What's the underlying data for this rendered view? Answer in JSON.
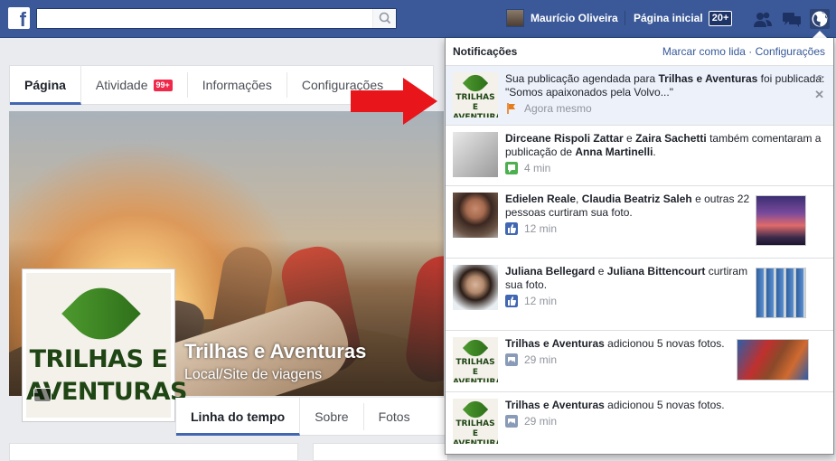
{
  "topbar": {
    "search_placeholder": "",
    "user_name": "Maurício Oliveira",
    "home_label": "Página inicial",
    "home_badge": "20+"
  },
  "page_nav": {
    "tabs": [
      {
        "label": "Página"
      },
      {
        "label": "Atividade",
        "badge": "99+"
      },
      {
        "label": "Informações"
      },
      {
        "label": "Configurações"
      }
    ]
  },
  "cover": {
    "page_title": "Trilhas e Aventuras",
    "page_category": "Local/Site de viagens",
    "logo_line1": "TRILHAS E",
    "logo_line2": "AVENTURAS"
  },
  "timeline_tabs": [
    {
      "label": "Linha do tempo"
    },
    {
      "label": "Sobre"
    },
    {
      "label": "Fotos"
    }
  ],
  "notifications": {
    "title": "Notificações",
    "mark_read": "Marcar como lida",
    "separator": "·",
    "settings": "Configurações",
    "items": [
      {
        "pre": "Sua publicação agendada para ",
        "bold1": "Trilhas e Aventuras",
        "post": " foi publicada: \"Somos apaixonados pela Volvo...\"",
        "time": "Agora mesmo",
        "icon": "flag-icon"
      },
      {
        "bold1": "Dirceane Rispoli Zattar",
        "mid": " e ",
        "bold2": "Zaira Sachetti",
        "post": " também comentaram a publicação de ",
        "bold3": "Anna Martinelli",
        "end": ".",
        "time": "4 min",
        "icon": "comment-icon"
      },
      {
        "bold1": "Edielen Reale",
        "mid": ", ",
        "bold2": "Claudia Beatriz Saleh",
        "post": " e outras 22 pessoas curtiram sua foto.",
        "time": "12 min",
        "icon": "like-icon"
      },
      {
        "bold1": "Juliana Bellegard",
        "mid": " e ",
        "bold2": "Juliana Bittencourt",
        "post": " curtiram sua foto.",
        "time": "12 min",
        "icon": "like-icon"
      },
      {
        "bold1": "Trilhas e Aventuras",
        "post": " adicionou 5 novas fotos.",
        "time": "29 min",
        "icon": "photo-icon"
      },
      {
        "bold1": "Trilhas e Aventuras",
        "post": " adicionou 5 novas fotos.",
        "time": "29 min",
        "icon": "photo-icon"
      }
    ]
  },
  "colors": {
    "brand_blue": "#3b5998",
    "unread_bg": "#edf2fa",
    "badge_red": "#f02849",
    "arrow_red": "#e8151b"
  }
}
